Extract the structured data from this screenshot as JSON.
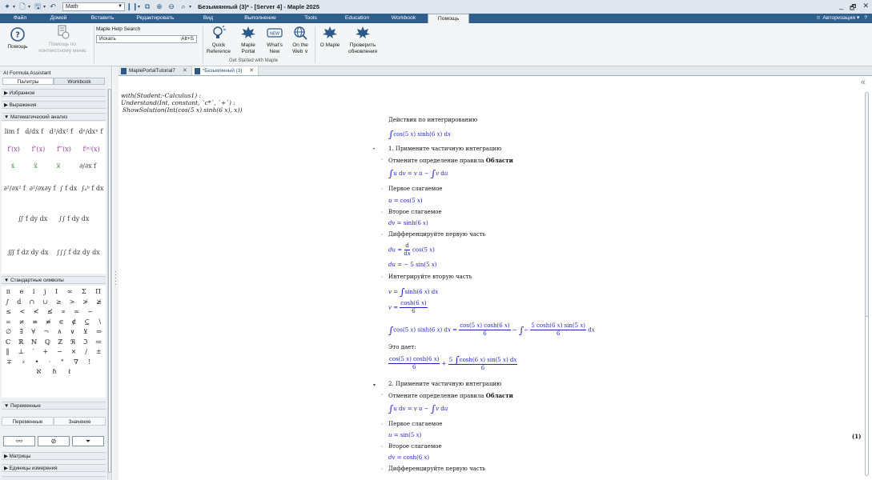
{
  "titlebar": {
    "mode": "Math",
    "title": "Безымянный (3)* - [Server 4] - Maple 2025",
    "win_min": "_",
    "win_max": "🗗",
    "win_close": "✕"
  },
  "menubar": {
    "tabs": [
      "Файл",
      "Домой",
      "Вставить",
      "Редактировать",
      "Вид",
      "Выполнение",
      "Tools",
      "Education",
      "Workbook",
      "Помощь"
    ],
    "active": "Помощь",
    "auth": "Авторизация ▾"
  },
  "ribbon": {
    "help_label": "Помощь",
    "context_help_label1": "Помощь по",
    "context_help_label2": "контекстному меню",
    "help_search_title": "Maple Help Search",
    "help_search_placeholder": "Искать",
    "help_search_shortcut": "Alt+S",
    "quick_ref_1": "Quick",
    "quick_ref_2": "Reference",
    "maple_portal_1": "Maple",
    "maple_portal_2": "Portal",
    "whats_new_1": "What's",
    "whats_new_2": "New",
    "on_web_1": "On the",
    "on_web_2": "Web ∨",
    "group_caption": "Get Started with Maple",
    "about_label": "О Maple",
    "check_updates_1": "Проверить",
    "check_updates_2": "обновления"
  },
  "leftpanel": {
    "ai_assistant": "AI Formula Assistant",
    "tabs": [
      "Палитры",
      "Workbook"
    ],
    "active_tab": "Палитры",
    "sections": {
      "favorites": "▶ Избранное",
      "expressions": "▶ Выражения",
      "calculus": "▼ Математический анализ",
      "symbols": "▼ Стандартные символы",
      "variables": "▼ Переменные",
      "matrices": "▶ Матрицы",
      "units": "▶ Единицы измерения"
    },
    "calculus_rows": [
      [
        "lim f",
        "d/dx f",
        "d²/dx² f",
        "dⁿ/dxⁿ f"
      ],
      [
        "f′(x)",
        "f″(x)",
        "f‴(x)",
        "f⁽ⁿ⁾(x)"
      ],
      [
        "ẋ",
        "ẍ",
        "x⃛",
        "∂/∂x f"
      ],
      [
        "∂²/∂x² f",
        "∂²/∂x∂y f",
        "∫ f dx",
        "∫ₐᵇ f dx"
      ],
      [
        "∬ f dy dx",
        "∫∫ f dy dx"
      ],
      [
        "∭ f dz dy dx",
        "∫∫∫ f dz dy dx"
      ]
    ],
    "symbol_rows": [
      [
        "π",
        "e",
        "i",
        "j",
        "I",
        "∞",
        "Σ",
        "Π"
      ],
      [
        "∫",
        "d",
        "∩",
        "∪",
        "≥",
        ">",
        "≯",
        "≱"
      ],
      [
        "≤",
        "<",
        "≮",
        "≰",
        "∝",
        "≈",
        "~",
        ""
      ],
      [
        "=",
        "≠",
        "≡",
        "≢",
        "∈",
        "∉",
        "⊆",
        "∖"
      ],
      [
        "∅",
        "∃",
        "∀",
        "¬",
        "∧",
        "∨",
        "⊻",
        "⇒"
      ],
      [
        "ℂ",
        "ℝ",
        "ℕ",
        "ℚ",
        "ℤ",
        "ℜ",
        "ℑ",
        "≔"
      ],
      [
        "‖",
        "⊥",
        "′",
        "+",
        "−",
        "×",
        "/",
        "±"
      ],
      [
        "∓",
        "∘",
        "•",
        "·",
        "°",
        "∇",
        "!",
        ""
      ],
      [
        "ℵ",
        "ℏ",
        "ℓ"
      ]
    ],
    "variables_cols": [
      "Переменные",
      "Значение"
    ],
    "var_btn_glasses": "👓",
    "var_btn_hide": "⊘",
    "var_btn_filter": "⏷"
  },
  "doctabs": [
    {
      "label": "MaplePortalTutorial7",
      "close": "✕"
    },
    {
      "label": "*Безымянный (3)",
      "close": "✕"
    }
  ],
  "document": {
    "input1": "with(Student:-Calculus1) :",
    "input2": "Understand(Int, constant, `c*`, `+`) :",
    "input3": "ShowSolution(Int(cos(5 x) sinh(6 x), x))",
    "heading": "Действия по интегрированию",
    "step1": "1. Примените частичную интеграцию",
    "step2": "2. Примените частичную интеграцию",
    "rule_prefix": "Отмените определение правила",
    "rule_bold": "Области",
    "first_term": "Первое слагаемое",
    "second_term": "Второе слагаемое",
    "diff_first": "Дифференцируйте первую часть",
    "integrate_second": "Интегрируйте вторую часть",
    "gives": "Это дает:",
    "eq_num": "(1)"
  }
}
